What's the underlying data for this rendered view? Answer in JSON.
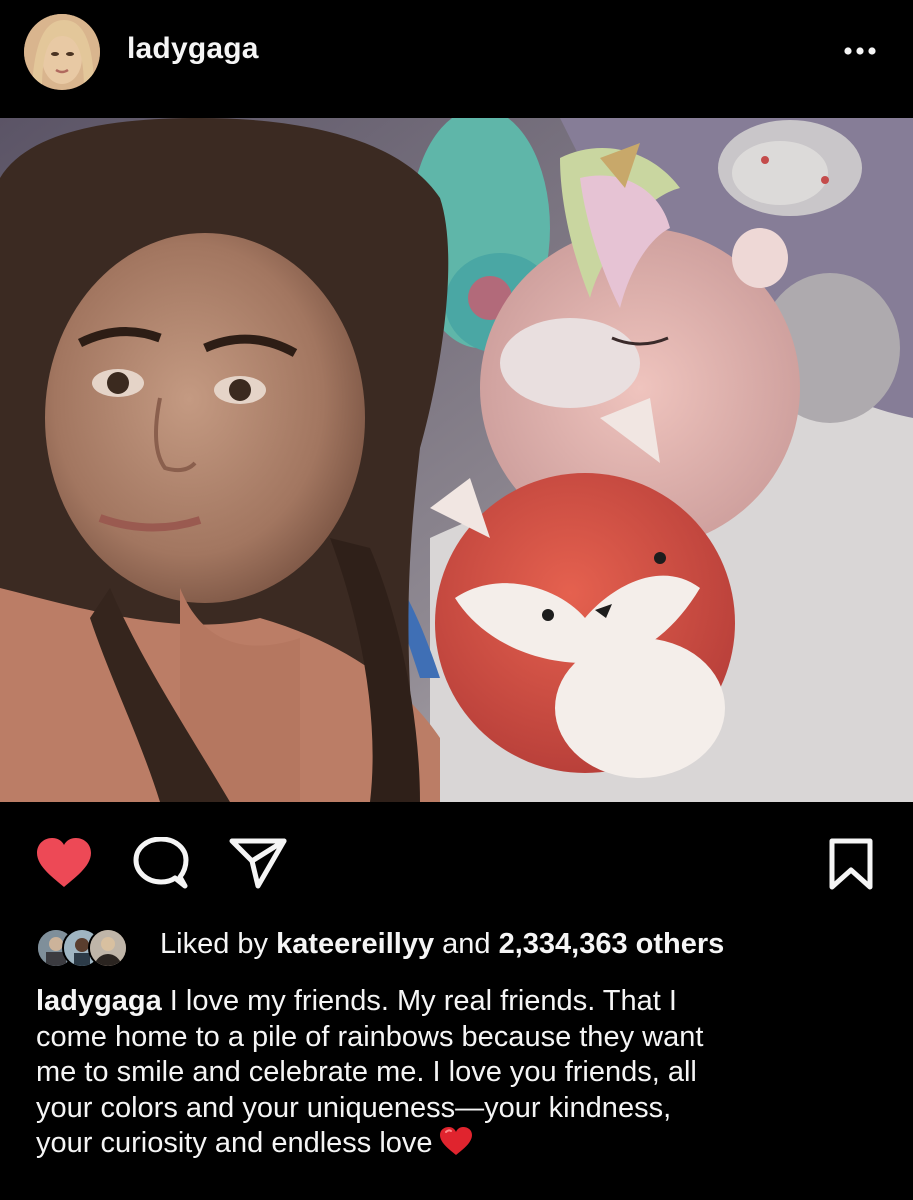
{
  "header": {
    "username": "ladygaga",
    "more_icon": "more-horizontal-icon"
  },
  "post": {
    "photo_icon": "photo",
    "actions": {
      "like_icon": "heart-filled-icon",
      "comment_icon": "comment-icon",
      "share_icon": "send-icon",
      "save_icon": "bookmark-icon",
      "like_color": "#ed4956"
    },
    "likes": {
      "prefix": "Liked by ",
      "liker": "kateereillyy",
      "middle": " and ",
      "count": "2,334,363 others"
    },
    "caption": {
      "username": "ladygaga",
      "lines": [
        " I love my friends.  My real friends. That I",
        "come home to a pile of rainbows because they want",
        "me to smile and celebrate me. I love you friends, all",
        "your colors and your uniqueness—your kindness,",
        "your curiosity and endless love"
      ],
      "emoji": "red-heart-emoji"
    }
  }
}
